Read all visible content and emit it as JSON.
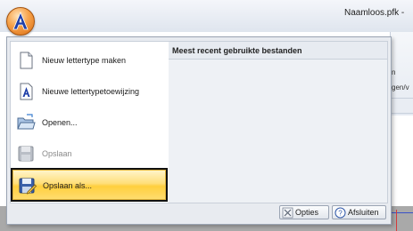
{
  "window": {
    "title": "Naamloos.pfk -"
  },
  "ribbon_fragments": {
    "top": "n",
    "middle": "gen/v"
  },
  "menu": {
    "commands": [
      {
        "label": "Nieuw lettertype maken",
        "icon": "new-document-icon",
        "enabled": true
      },
      {
        "label": "Nieuwe lettertypetoewijzing",
        "icon": "font-assignment-icon",
        "enabled": true
      },
      {
        "label": "Openen...",
        "icon": "open-folder-icon",
        "enabled": true
      },
      {
        "label": "Opslaan",
        "icon": "save-icon",
        "enabled": false
      },
      {
        "label": "Opslaan als...",
        "icon": "save-as-icon",
        "enabled": true,
        "selected": true
      }
    ],
    "recent_files": {
      "header": "Meest recent gebruikte bestanden",
      "items": []
    },
    "footer": {
      "options_label": "Opties",
      "exit_label": "Afsluiten"
    }
  },
  "colors": {
    "highlight": "#ffd75a",
    "app_button": "#f08a24",
    "menu_background": "#e8ebf0"
  }
}
